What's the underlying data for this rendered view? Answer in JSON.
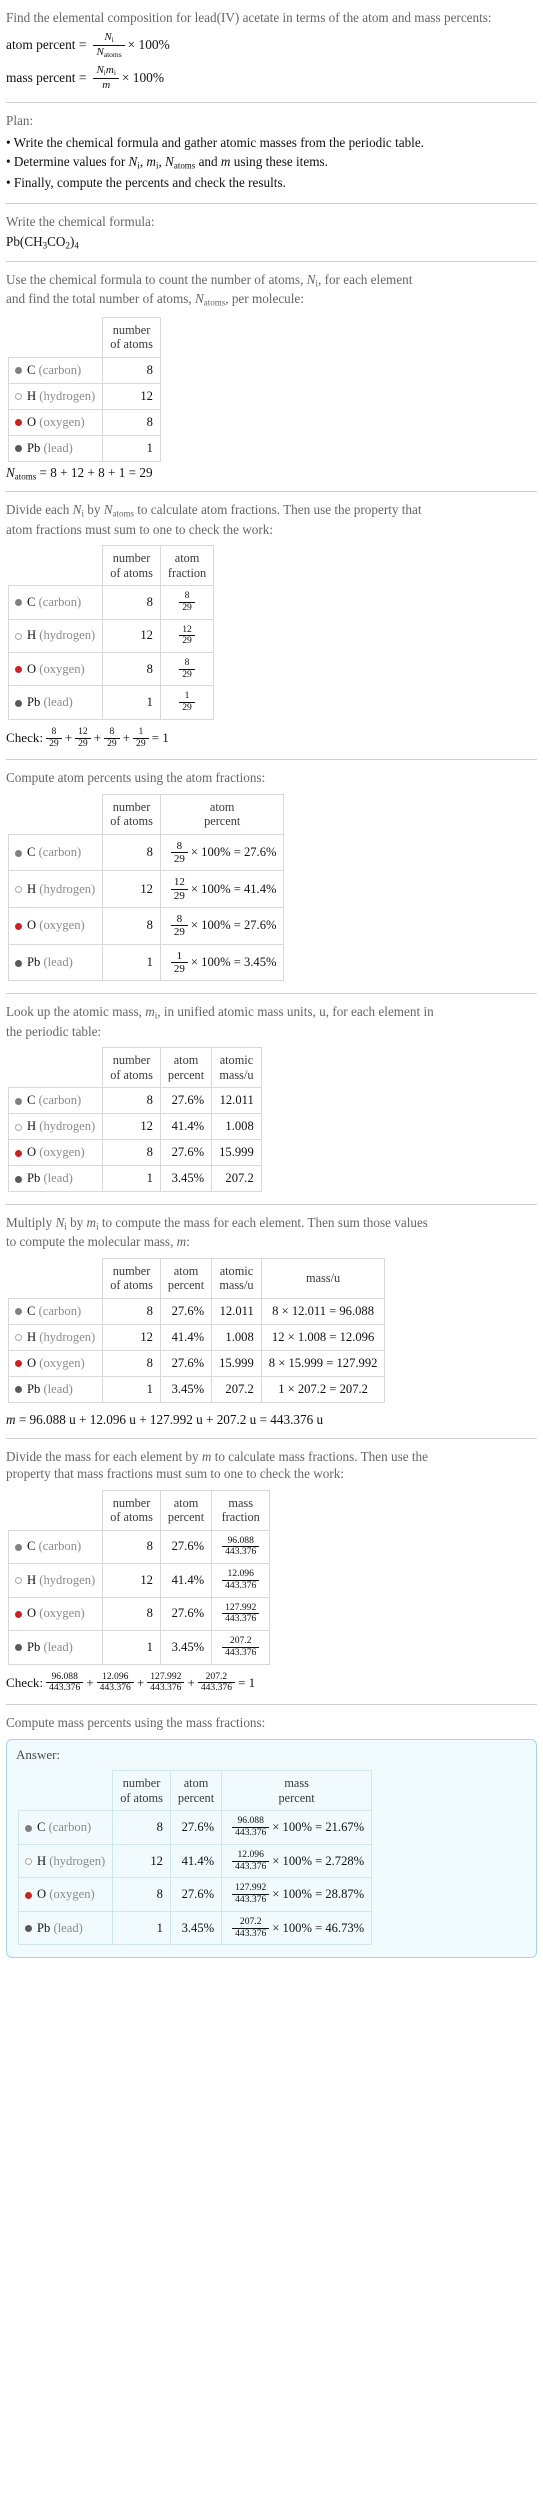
{
  "intro": {
    "question": "Find the elemental composition for lead(IV) acetate in terms of the atom and mass percents:",
    "atom_percent_label": "atom percent =",
    "atom_percent_num": "N",
    "atom_percent_num_sub": "i",
    "atom_percent_den": "N",
    "atom_percent_den_sub": "atoms",
    "times100": "× 100%",
    "mass_percent_label": "mass percent =",
    "mass_percent_num": "N",
    "mass_percent_num_sub": "i",
    "mass_percent_num2": "m",
    "mass_percent_num2_sub": "i",
    "mass_percent_den": "m"
  },
  "plan": {
    "title": "Plan:",
    "items": [
      "• Write the chemical formula and gather atomic masses from the periodic table.",
      "• Determine values for N_i, m_i, N_atoms and m using these items.",
      "• Finally, compute the percents and check the results."
    ],
    "item2_parts": {
      "lead": "• Determine values for ",
      "n": "N",
      "n_sub": "i",
      "comma1": ", ",
      "m": "m",
      "m_sub": "i",
      "comma2": ", ",
      "natoms": "N",
      "natoms_sub": "atoms",
      "and": " and ",
      "mm": "m",
      "tail": " using these items."
    }
  },
  "formula_step": {
    "prompt": "Write the chemical formula:",
    "formula_parts": [
      "Pb(CH",
      "3",
      "CO",
      "2",
      ")",
      "4"
    ],
    "formula_plain": "Pb(CH3CO2)4"
  },
  "count_step": {
    "prompt_line1": "Use the chemical formula to count the number of atoms, N_i, for each element",
    "prompt_line2": "and find the total number of atoms, N_atoms, per molecule:",
    "prompt_p1": "Use the chemical formula to count the number of atoms, ",
    "prompt_p2": ", for each element",
    "prompt_p3": "and find the total number of atoms, ",
    "prompt_p4": ", per molecule:",
    "header": "number of atoms",
    "header_l1": "number",
    "header_l2": "of atoms",
    "rows": [
      {
        "symbol": "C",
        "name": "(carbon)",
        "color": "#808080",
        "hollow": false,
        "count": "8"
      },
      {
        "symbol": "H",
        "name": "(hydrogen)",
        "color": "#ffffff",
        "hollow": true,
        "count": "12"
      },
      {
        "symbol": "O",
        "name": "(oxygen)",
        "color": "#cc2222",
        "hollow": false,
        "count": "8"
      },
      {
        "symbol": "Pb",
        "name": "(lead)",
        "color": "#5a5a5a",
        "hollow": false,
        "count": "1"
      }
    ],
    "total_line": "N_atoms = 8 + 12 + 8 + 1 = 29",
    "total_prefix": "N",
    "total_sub": "atoms",
    "total_expr": " = 8 + 12 + 8 + 1 = 29"
  },
  "fraction_step": {
    "prompt_l1": "Divide each N_i by N_atoms to calculate atom fractions. Then use the property that",
    "prompt_l2": "atom fractions must sum to one to check the work:",
    "p1": "Divide each ",
    "p2": " by ",
    "p3": " to calculate atom fractions. Then use the property that",
    "p4": "atom fractions must sum to one to check the work:",
    "headers": [
      [
        "number",
        "of atoms"
      ],
      [
        "atom",
        "fraction"
      ]
    ],
    "rows": [
      {
        "symbol": "C",
        "name": "(carbon)",
        "color": "#808080",
        "hollow": false,
        "count": "8",
        "num": "8",
        "den": "29"
      },
      {
        "symbol": "H",
        "name": "(hydrogen)",
        "color": "#ffffff",
        "hollow": true,
        "count": "12",
        "num": "12",
        "den": "29"
      },
      {
        "symbol": "O",
        "name": "(oxygen)",
        "color": "#cc2222",
        "hollow": false,
        "count": "8",
        "num": "8",
        "den": "29"
      },
      {
        "symbol": "Pb",
        "name": "(lead)",
        "color": "#5a5a5a",
        "hollow": false,
        "count": "1",
        "num": "1",
        "den": "29"
      }
    ],
    "check_label": "Check:",
    "check_terms": [
      [
        "8",
        "29"
      ],
      [
        "12",
        "29"
      ],
      [
        "8",
        "29"
      ],
      [
        "1",
        "29"
      ]
    ],
    "check_result": "= 1"
  },
  "atom_percent_step": {
    "prompt": "Compute atom percents using the atom fractions:",
    "headers": [
      [
        "number",
        "of atoms"
      ],
      [
        "atom",
        "percent"
      ]
    ],
    "rows": [
      {
        "symbol": "C",
        "name": "(carbon)",
        "color": "#808080",
        "hollow": false,
        "count": "8",
        "num": "8",
        "den": "29",
        "result": "× 100% = 27.6%"
      },
      {
        "symbol": "H",
        "name": "(hydrogen)",
        "color": "#ffffff",
        "hollow": true,
        "count": "12",
        "num": "12",
        "den": "29",
        "result": "× 100% = 41.4%"
      },
      {
        "symbol": "O",
        "name": "(oxygen)",
        "color": "#cc2222",
        "hollow": false,
        "count": "8",
        "num": "8",
        "den": "29",
        "result": "× 100% = 27.6%"
      },
      {
        "symbol": "Pb",
        "name": "(lead)",
        "color": "#5a5a5a",
        "hollow": false,
        "count": "1",
        "num": "1",
        "den": "29",
        "result": "× 100% = 3.45%"
      }
    ]
  },
  "mass_lookup_step": {
    "prompt_l1": "Look up the atomic mass, m_i, in unified atomic mass units, u, for each element in",
    "prompt_l2": "the periodic table:",
    "p1": "Look up the atomic mass, ",
    "p2": ", in unified atomic mass units, u, for each element in",
    "p3": "the periodic table:",
    "headers": [
      [
        "number",
        "of atoms"
      ],
      [
        "atom",
        "percent"
      ],
      [
        "atomic",
        "mass/u"
      ]
    ],
    "rows": [
      {
        "symbol": "C",
        "name": "(carbon)",
        "color": "#808080",
        "hollow": false,
        "count": "8",
        "percent": "27.6%",
        "mass": "12.011"
      },
      {
        "symbol": "H",
        "name": "(hydrogen)",
        "color": "#ffffff",
        "hollow": true,
        "count": "12",
        "percent": "41.4%",
        "mass": "1.008"
      },
      {
        "symbol": "O",
        "name": "(oxygen)",
        "color": "#cc2222",
        "hollow": false,
        "count": "8",
        "percent": "27.6%",
        "mass": "15.999"
      },
      {
        "symbol": "Pb",
        "name": "(lead)",
        "color": "#5a5a5a",
        "hollow": false,
        "count": "1",
        "percent": "3.45%",
        "mass": "207.2"
      }
    ]
  },
  "molecular_mass_step": {
    "prompt_l1": "Multiply N_i by m_i to compute the mass for each element. Then sum those values",
    "prompt_l2": "to compute the molecular mass, m:",
    "p1": "Multiply ",
    "p2": " by ",
    "p3": " to compute the mass for each element. Then sum those values",
    "p4": "to compute the molecular mass, ",
    "p5": ":",
    "headers": [
      [
        "number",
        "of atoms"
      ],
      [
        "atom",
        "percent"
      ],
      [
        "atomic",
        "mass/u"
      ],
      [
        "mass/u"
      ]
    ],
    "rows": [
      {
        "symbol": "C",
        "name": "(carbon)",
        "color": "#808080",
        "hollow": false,
        "count": "8",
        "percent": "27.6%",
        "mass": "12.011",
        "product": "8 × 12.011 = 96.088"
      },
      {
        "symbol": "H",
        "name": "(hydrogen)",
        "color": "#ffffff",
        "hollow": true,
        "count": "12",
        "percent": "41.4%",
        "mass": "1.008",
        "product": "12 × 1.008 = 12.096"
      },
      {
        "symbol": "O",
        "name": "(oxygen)",
        "color": "#cc2222",
        "hollow": false,
        "count": "8",
        "percent": "27.6%",
        "mass": "15.999",
        "product": "8 × 15.999 = 127.992"
      },
      {
        "symbol": "Pb",
        "name": "(lead)",
        "color": "#5a5a5a",
        "hollow": false,
        "count": "1",
        "percent": "3.45%",
        "mass": "207.2",
        "product": "1 × 207.2 = 207.2"
      }
    ],
    "sum_prefix": "m",
    "sum_line": " = 96.088 u + 12.096 u + 127.992 u + 207.2 u = 443.376 u"
  },
  "mass_fraction_step": {
    "prompt_l1": "Divide the mass for each element by m to calculate mass fractions. Then use the",
    "prompt_l2": "property that mass fractions must sum to one to check the work:",
    "p1": "Divide the mass for each element by ",
    "p2": " to calculate mass fractions. Then use the",
    "p3": "property that mass fractions must sum to one to check the work:",
    "headers": [
      [
        "number",
        "of atoms"
      ],
      [
        "atom",
        "percent"
      ],
      [
        "mass",
        "fraction"
      ]
    ],
    "rows": [
      {
        "symbol": "C",
        "name": "(carbon)",
        "color": "#808080",
        "hollow": false,
        "count": "8",
        "percent": "27.6%",
        "num": "96.088",
        "den": "443.376"
      },
      {
        "symbol": "H",
        "name": "(hydrogen)",
        "color": "#ffffff",
        "hollow": true,
        "count": "12",
        "percent": "41.4%",
        "num": "12.096",
        "den": "443.376"
      },
      {
        "symbol": "O",
        "name": "(oxygen)",
        "color": "#cc2222",
        "hollow": false,
        "count": "8",
        "percent": "27.6%",
        "num": "127.992",
        "den": "443.376"
      },
      {
        "symbol": "Pb",
        "name": "(lead)",
        "color": "#5a5a5a",
        "hollow": false,
        "count": "1",
        "percent": "3.45%",
        "num": "207.2",
        "den": "443.376"
      }
    ],
    "check_label": "Check:",
    "check_terms": [
      [
        "96.088",
        "443.376"
      ],
      [
        "12.096",
        "443.376"
      ],
      [
        "127.992",
        "443.376"
      ],
      [
        "207.2",
        "443.376"
      ]
    ],
    "check_result": "= 1"
  },
  "mass_percent_step": {
    "prompt": "Compute mass percents using the mass fractions:",
    "answer_label": "Answer:",
    "headers": [
      [
        "number",
        "of atoms"
      ],
      [
        "atom",
        "percent"
      ],
      [
        "mass",
        "percent"
      ]
    ],
    "rows": [
      {
        "symbol": "C",
        "name": "(carbon)",
        "color": "#808080",
        "hollow": false,
        "count": "8",
        "percent": "27.6%",
        "num": "96.088",
        "den": "443.376",
        "result": "× 100% = 21.67%"
      },
      {
        "symbol": "H",
        "name": "(hydrogen)",
        "color": "#ffffff",
        "hollow": true,
        "count": "12",
        "percent": "41.4%",
        "num": "12.096",
        "den": "443.376",
        "result": "× 100% = 2.728%"
      },
      {
        "symbol": "O",
        "name": "(oxygen)",
        "color": "#cc2222",
        "hollow": false,
        "count": "8",
        "percent": "27.6%",
        "num": "127.992",
        "den": "443.376",
        "result": "× 100% = 28.87%"
      },
      {
        "symbol": "Pb",
        "name": "(lead)",
        "color": "#5a5a5a",
        "hollow": false,
        "count": "1",
        "percent": "3.45%",
        "num": "207.2",
        "den": "443.376",
        "result": "× 100% = 46.73%"
      }
    ]
  }
}
